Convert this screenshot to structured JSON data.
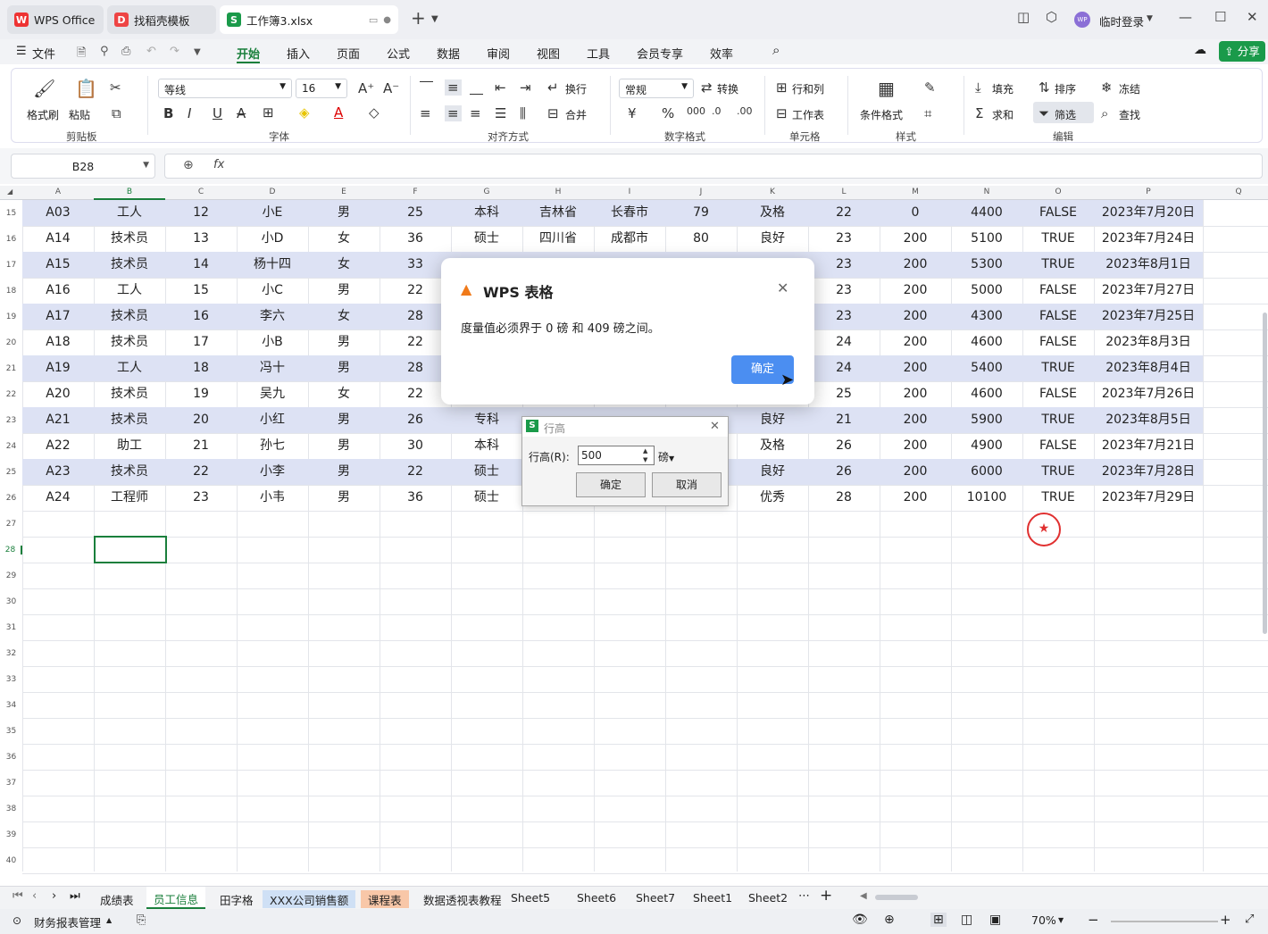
{
  "titlebar": {
    "tabs": [
      {
        "label": "WPS Office",
        "logo": "W"
      },
      {
        "label": "找稻壳模板",
        "logo": "D"
      },
      {
        "label": "工作簿3.xlsx",
        "logo": "S"
      }
    ],
    "login": "临时登录",
    "avatar": "WP"
  },
  "menubar": {
    "file": "文件",
    "items": [
      "开始",
      "插入",
      "页面",
      "公式",
      "数据",
      "审阅",
      "视图",
      "工具",
      "会员专享",
      "效率"
    ],
    "share": "分享"
  },
  "ribbon": {
    "groups": {
      "clipboard": "剪贴板",
      "font": "字体",
      "align": "对齐方式",
      "number": "数字格式",
      "cell": "单元格",
      "style": "样式",
      "edit": "编辑"
    },
    "format_painter": "格式刷",
    "paste": "粘贴",
    "font_name": "等线",
    "font_size": "16",
    "wrap": "换行",
    "merge": "合并",
    "number_format": "常规",
    "convert": "转换",
    "rowcol": "行和列",
    "sheet": "工作表",
    "cond_format": "条件格式",
    "fill": "填充",
    "sort": "排序",
    "freeze": "冻结",
    "sum": "求和",
    "filter": "筛选",
    "find": "查找"
  },
  "formula": {
    "cell_ref": "B28",
    "fx": "fx"
  },
  "columns": [
    "A",
    "B",
    "C",
    "D",
    "E",
    "F",
    "G",
    "H",
    "I",
    "J",
    "K",
    "L",
    "M",
    "N",
    "O",
    "P",
    "Q"
  ],
  "rows": [
    {
      "num": "15",
      "cells": [
        "A03",
        "工人",
        "12",
        "小E",
        "男",
        "25",
        "本科",
        "吉林省",
        "长春市",
        "79",
        "及格",
        "22",
        "0",
        "4400",
        "FALSE",
        "2023年7月20日"
      ]
    },
    {
      "num": "16",
      "cells": [
        "A14",
        "技术员",
        "13",
        "小D",
        "女",
        "36",
        "硕士",
        "四川省",
        "成都市",
        "80",
        "良好",
        "23",
        "200",
        "5100",
        "TRUE",
        "2023年7月24日"
      ]
    },
    {
      "num": "17",
      "cells": [
        "A15",
        "技术员",
        "14",
        "杨十四",
        "女",
        "33",
        "",
        "",
        "",
        "",
        "",
        "23",
        "200",
        "5300",
        "TRUE",
        "2023年8月1日"
      ]
    },
    {
      "num": "18",
      "cells": [
        "A16",
        "工人",
        "15",
        "小C",
        "男",
        "22",
        "",
        "",
        "",
        "",
        "",
        "23",
        "200",
        "5000",
        "FALSE",
        "2023年7月27日"
      ]
    },
    {
      "num": "19",
      "cells": [
        "A17",
        "技术员",
        "16",
        "李六",
        "女",
        "28",
        "",
        "",
        "",
        "",
        "",
        "23",
        "200",
        "4300",
        "FALSE",
        "2023年7月25日"
      ]
    },
    {
      "num": "20",
      "cells": [
        "A18",
        "技术员",
        "17",
        "小B",
        "男",
        "22",
        "",
        "",
        "",
        "",
        "",
        "24",
        "200",
        "4600",
        "FALSE",
        "2023年8月3日"
      ]
    },
    {
      "num": "21",
      "cells": [
        "A19",
        "工人",
        "18",
        "冯十",
        "男",
        "28",
        "",
        "",
        "",
        "",
        "",
        "24",
        "200",
        "5400",
        "TRUE",
        "2023年8月4日"
      ]
    },
    {
      "num": "22",
      "cells": [
        "A20",
        "技术员",
        "19",
        "吴九",
        "女",
        "22",
        "",
        "",
        "",
        "",
        "",
        "25",
        "200",
        "4600",
        "FALSE",
        "2023年7月26日"
      ]
    },
    {
      "num": "23",
      "cells": [
        "A21",
        "技术员",
        "20",
        "小红",
        "男",
        "26",
        "专科",
        "",
        "",
        "",
        "良好",
        "21",
        "200",
        "5900",
        "TRUE",
        "2023年8月5日"
      ]
    },
    {
      "num": "24",
      "cells": [
        "A22",
        "助工",
        "21",
        "孙七",
        "男",
        "30",
        "本科",
        "",
        "",
        "",
        "及格",
        "26",
        "200",
        "4900",
        "FALSE",
        "2023年7月21日"
      ]
    },
    {
      "num": "25",
      "cells": [
        "A23",
        "技术员",
        "22",
        "小李",
        "男",
        "22",
        "硕士",
        "",
        "",
        "",
        "良好",
        "26",
        "200",
        "6000",
        "TRUE",
        "2023年7月28日"
      ]
    },
    {
      "num": "26",
      "cells": [
        "A24",
        "工程师",
        "23",
        "小韦",
        "男",
        "36",
        "硕士",
        "",
        "",
        "",
        "优秀",
        "28",
        "200",
        "10100",
        "TRUE",
        "2023年7月29日"
      ]
    }
  ],
  "empty_rows": [
    "27",
    "28",
    "29",
    "30",
    "31",
    "32",
    "33",
    "34",
    "35",
    "36",
    "37",
    "38",
    "39",
    "40"
  ],
  "alert": {
    "title": "WPS 表格",
    "message": "度量值必须界于 0 磅 和 409 磅之间。",
    "ok": "确定"
  },
  "row_height_dialog": {
    "title": "行高",
    "label": "行高(R):",
    "value": "500",
    "unit": "磅",
    "ok": "确定",
    "cancel": "取消"
  },
  "sheets": [
    "成绩表",
    "员工信息",
    "田字格",
    "XXX公司销售额",
    "课程表",
    "数据透视表教程",
    "Sheet5",
    "Sheet6",
    "Sheet7",
    "Sheet1",
    "Sheet2"
  ],
  "active_sheet": "员工信息",
  "status": {
    "macro": "财务报表管理",
    "zoom": "70%"
  },
  "colors": {
    "accent": "#1a7f3c",
    "band": "#dde2f4",
    "alert_btn": "#4b8ef1",
    "warn": "#f07a1a"
  }
}
